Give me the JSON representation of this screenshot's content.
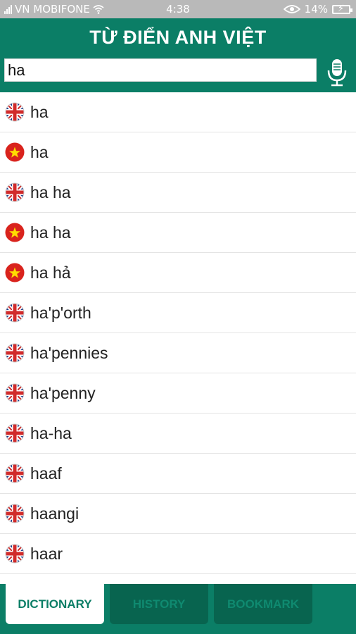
{
  "status_bar": {
    "carrier": "VN MOBIFONE",
    "time": "4:38",
    "battery": "14%"
  },
  "header": {
    "title": "TỪ ĐIỂN ANH VIỆT",
    "search_value": "ha"
  },
  "icons": {
    "mic": "microphone-icon",
    "en": "uk-flag-icon",
    "vi": "vietnam-flag-icon"
  },
  "results": [
    {
      "word": "ha",
      "lang": "en"
    },
    {
      "word": "ha",
      "lang": "vi"
    },
    {
      "word": "ha ha",
      "lang": "en"
    },
    {
      "word": "ha ha",
      "lang": "vi"
    },
    {
      "word": "ha hả",
      "lang": "vi"
    },
    {
      "word": "ha'p'orth",
      "lang": "en"
    },
    {
      "word": "ha'pennies",
      "lang": "en"
    },
    {
      "word": "ha'penny",
      "lang": "en"
    },
    {
      "word": "ha-ha",
      "lang": "en"
    },
    {
      "word": "haaf",
      "lang": "en"
    },
    {
      "word": "haangi",
      "lang": "en"
    },
    {
      "word": "haar",
      "lang": "en"
    }
  ],
  "tabs": [
    {
      "label": "DICTIONARY",
      "active": true
    },
    {
      "label": "HISTORY",
      "active": false
    },
    {
      "label": "BOOKMARK",
      "active": false
    }
  ],
  "colors": {
    "brand": "#0b7e66",
    "tab_inactive": "#08644f"
  }
}
